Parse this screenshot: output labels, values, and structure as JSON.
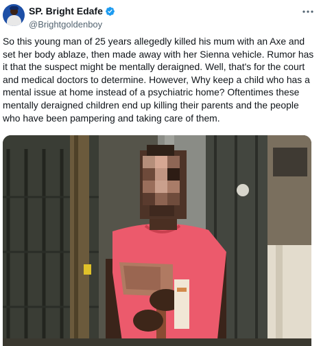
{
  "tweet": {
    "author": {
      "display_name": "SP. Bright Edafe",
      "handle": "@Brightgoldenboy",
      "verified": true
    },
    "more_icon": "more-horizontal-icon",
    "text": "So this young man of 25 years allegedly killed his mum with an Axe and set her body ablaze, then made away with her Sienna vehicle. Rumor has it that the suspect might be mentally deraigned. Well, that's for the court and medical doctors to determine. However,   Why keep a child who has a mental issue at home instead of a psychiatric home? Oftentimes these mentally deraigned children end up killing their parents and the people who have been pampering and taking care of them."
  },
  "colors": {
    "text": "#0f1419",
    "secondary": "#536471",
    "verified_badge": "#1d9bf0",
    "shirt": "#ec5a6c"
  }
}
